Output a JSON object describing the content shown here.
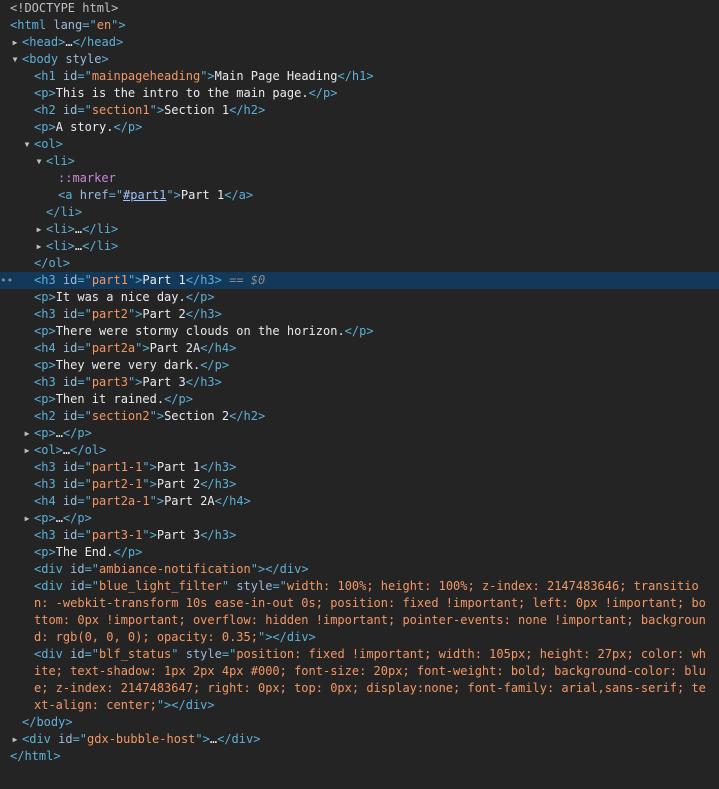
{
  "colors": {
    "background": "#242424",
    "selection": "#12385a",
    "tag": "#5db0d7",
    "attr_name": "#9bbbdc",
    "attr_value": "#f29766",
    "text": "#e8eaed"
  },
  "lines": [
    {
      "depth": 0,
      "parts": [
        {
          "c": "doctype",
          "t": "<!DOCTYPE html>"
        }
      ]
    },
    {
      "depth": 0,
      "parts": [
        {
          "c": "tag",
          "t": "<html "
        },
        {
          "c": "an",
          "t": "lang"
        },
        {
          "c": "tag",
          "t": "=\""
        },
        {
          "c": "av",
          "t": "en"
        },
        {
          "c": "tag",
          "t": "\">"
        }
      ]
    },
    {
      "depth": 1,
      "tri": "right",
      "parts": [
        {
          "c": "tag",
          "t": "<head>"
        },
        {
          "c": "ell",
          "t": "…"
        },
        {
          "c": "tag",
          "t": "</head>"
        }
      ]
    },
    {
      "depth": 1,
      "tri": "down",
      "parts": [
        {
          "c": "tag",
          "t": "<body "
        },
        {
          "c": "an",
          "t": "style"
        },
        {
          "c": "tag",
          "t": ">"
        }
      ]
    },
    {
      "depth": 2,
      "parts": [
        {
          "c": "tag",
          "t": "<h1 "
        },
        {
          "c": "an",
          "t": "id"
        },
        {
          "c": "tag",
          "t": "=\""
        },
        {
          "c": "av",
          "t": "mainpageheading"
        },
        {
          "c": "tag",
          "t": "\">"
        },
        {
          "c": "txt",
          "t": "Main Page Heading"
        },
        {
          "c": "tag",
          "t": "</h1>"
        }
      ]
    },
    {
      "depth": 2,
      "parts": [
        {
          "c": "tag",
          "t": "<p>"
        },
        {
          "c": "txt",
          "t": "This is the intro to the main page."
        },
        {
          "c": "tag",
          "t": "</p>"
        }
      ]
    },
    {
      "depth": 2,
      "parts": [
        {
          "c": "tag",
          "t": "<h2 "
        },
        {
          "c": "an",
          "t": "id"
        },
        {
          "c": "tag",
          "t": "=\""
        },
        {
          "c": "av",
          "t": "section1"
        },
        {
          "c": "tag",
          "t": "\">"
        },
        {
          "c": "txt",
          "t": "Section 1"
        },
        {
          "c": "tag",
          "t": "</h2>"
        }
      ]
    },
    {
      "depth": 2,
      "parts": [
        {
          "c": "tag",
          "t": "<p>"
        },
        {
          "c": "txt",
          "t": "A story."
        },
        {
          "c": "tag",
          "t": "</p>"
        }
      ]
    },
    {
      "depth": 2,
      "tri": "down",
      "parts": [
        {
          "c": "tag",
          "t": "<ol>"
        }
      ]
    },
    {
      "depth": 3,
      "tri": "down",
      "parts": [
        {
          "c": "tag",
          "t": "<li>"
        }
      ]
    },
    {
      "depth": 4,
      "parts": [
        {
          "c": "pseudo",
          "t": "::marker"
        }
      ]
    },
    {
      "depth": 4,
      "parts": [
        {
          "c": "tag",
          "t": "<a "
        },
        {
          "c": "an",
          "t": "href"
        },
        {
          "c": "tag",
          "t": "=\""
        },
        {
          "c": "av link",
          "t": "#part1"
        },
        {
          "c": "tag",
          "t": "\">"
        },
        {
          "c": "txt",
          "t": "Part 1"
        },
        {
          "c": "tag",
          "t": "</a>"
        }
      ]
    },
    {
      "depth": 3,
      "parts": [
        {
          "c": "tag",
          "t": "</li>"
        }
      ]
    },
    {
      "depth": 3,
      "tri": "right",
      "parts": [
        {
          "c": "tag",
          "t": "<li>"
        },
        {
          "c": "ell",
          "t": "…"
        },
        {
          "c": "tag",
          "t": "</li>"
        }
      ]
    },
    {
      "depth": 3,
      "tri": "right",
      "parts": [
        {
          "c": "tag",
          "t": "<li>"
        },
        {
          "c": "ell",
          "t": "…"
        },
        {
          "c": "tag",
          "t": "</li>"
        }
      ]
    },
    {
      "depth": 2,
      "parts": [
        {
          "c": "tag",
          "t": "</ol>"
        }
      ]
    },
    {
      "depth": 2,
      "selected": true,
      "parts": [
        {
          "c": "tag",
          "t": "<h3 "
        },
        {
          "c": "an",
          "t": "id"
        },
        {
          "c": "tag",
          "t": "=\""
        },
        {
          "c": "av",
          "t": "part1"
        },
        {
          "c": "tag",
          "t": "\">"
        },
        {
          "c": "txt",
          "t": "Part 1"
        },
        {
          "c": "tag",
          "t": "</h3>"
        },
        {
          "c": "eq",
          "t": " == $0"
        }
      ]
    },
    {
      "depth": 2,
      "parts": [
        {
          "c": "tag",
          "t": "<p>"
        },
        {
          "c": "txt",
          "t": "It was a nice day."
        },
        {
          "c": "tag",
          "t": "</p>"
        }
      ]
    },
    {
      "depth": 2,
      "parts": [
        {
          "c": "tag",
          "t": "<h3 "
        },
        {
          "c": "an",
          "t": "id"
        },
        {
          "c": "tag",
          "t": "=\""
        },
        {
          "c": "av",
          "t": "part2"
        },
        {
          "c": "tag",
          "t": "\">"
        },
        {
          "c": "txt",
          "t": "Part 2"
        },
        {
          "c": "tag",
          "t": "</h3>"
        }
      ]
    },
    {
      "depth": 2,
      "parts": [
        {
          "c": "tag",
          "t": "<p>"
        },
        {
          "c": "txt",
          "t": "There were stormy clouds on the horizon."
        },
        {
          "c": "tag",
          "t": "</p>"
        }
      ]
    },
    {
      "depth": 2,
      "parts": [
        {
          "c": "tag",
          "t": "<h4 "
        },
        {
          "c": "an",
          "t": "id"
        },
        {
          "c": "tag",
          "t": "=\""
        },
        {
          "c": "av",
          "t": "part2a"
        },
        {
          "c": "tag",
          "t": "\">"
        },
        {
          "c": "txt",
          "t": "Part 2A"
        },
        {
          "c": "tag",
          "t": "</h4>"
        }
      ]
    },
    {
      "depth": 2,
      "parts": [
        {
          "c": "tag",
          "t": "<p>"
        },
        {
          "c": "txt",
          "t": "They were very dark."
        },
        {
          "c": "tag",
          "t": "</p>"
        }
      ]
    },
    {
      "depth": 2,
      "parts": [
        {
          "c": "tag",
          "t": "<h3 "
        },
        {
          "c": "an",
          "t": "id"
        },
        {
          "c": "tag",
          "t": "=\""
        },
        {
          "c": "av",
          "t": "part3"
        },
        {
          "c": "tag",
          "t": "\">"
        },
        {
          "c": "txt",
          "t": "Part 3"
        },
        {
          "c": "tag",
          "t": "</h3>"
        }
      ]
    },
    {
      "depth": 2,
      "parts": [
        {
          "c": "tag",
          "t": "<p>"
        },
        {
          "c": "txt",
          "t": "Then it rained."
        },
        {
          "c": "tag",
          "t": "</p>"
        }
      ]
    },
    {
      "depth": 2,
      "parts": [
        {
          "c": "tag",
          "t": "<h2 "
        },
        {
          "c": "an",
          "t": "id"
        },
        {
          "c": "tag",
          "t": "=\""
        },
        {
          "c": "av",
          "t": "section2"
        },
        {
          "c": "tag",
          "t": "\">"
        },
        {
          "c": "txt",
          "t": "Section 2"
        },
        {
          "c": "tag",
          "t": "</h2>"
        }
      ]
    },
    {
      "depth": 2,
      "tri": "right",
      "parts": [
        {
          "c": "tag",
          "t": "<p>"
        },
        {
          "c": "ell",
          "t": "…"
        },
        {
          "c": "tag",
          "t": "</p>"
        }
      ]
    },
    {
      "depth": 2,
      "tri": "right",
      "parts": [
        {
          "c": "tag",
          "t": "<ol>"
        },
        {
          "c": "ell",
          "t": "…"
        },
        {
          "c": "tag",
          "t": "</ol>"
        }
      ]
    },
    {
      "depth": 2,
      "parts": [
        {
          "c": "tag",
          "t": "<h3 "
        },
        {
          "c": "an",
          "t": "id"
        },
        {
          "c": "tag",
          "t": "=\""
        },
        {
          "c": "av",
          "t": "part1-1"
        },
        {
          "c": "tag",
          "t": "\">"
        },
        {
          "c": "txt",
          "t": "Part 1"
        },
        {
          "c": "tag",
          "t": "</h3>"
        }
      ]
    },
    {
      "depth": 2,
      "parts": [
        {
          "c": "tag",
          "t": "<h3 "
        },
        {
          "c": "an",
          "t": "id"
        },
        {
          "c": "tag",
          "t": "=\""
        },
        {
          "c": "av",
          "t": "part2-1"
        },
        {
          "c": "tag",
          "t": "\">"
        },
        {
          "c": "txt",
          "t": "Part 2"
        },
        {
          "c": "tag",
          "t": "</h3>"
        }
      ]
    },
    {
      "depth": 2,
      "parts": [
        {
          "c": "tag",
          "t": "<h4 "
        },
        {
          "c": "an",
          "t": "id"
        },
        {
          "c": "tag",
          "t": "=\""
        },
        {
          "c": "av",
          "t": "part2a-1"
        },
        {
          "c": "tag",
          "t": "\">"
        },
        {
          "c": "txt",
          "t": "Part 2A"
        },
        {
          "c": "tag",
          "t": "</h4>"
        }
      ]
    },
    {
      "depth": 2,
      "tri": "right",
      "parts": [
        {
          "c": "tag",
          "t": "<p>"
        },
        {
          "c": "ell",
          "t": "…"
        },
        {
          "c": "tag",
          "t": "</p>"
        }
      ]
    },
    {
      "depth": 2,
      "parts": [
        {
          "c": "tag",
          "t": "<h3 "
        },
        {
          "c": "an",
          "t": "id"
        },
        {
          "c": "tag",
          "t": "=\""
        },
        {
          "c": "av",
          "t": "part3-1"
        },
        {
          "c": "tag",
          "t": "\">"
        },
        {
          "c": "txt",
          "t": "Part 3"
        },
        {
          "c": "tag",
          "t": "</h3>"
        }
      ]
    },
    {
      "depth": 2,
      "parts": [
        {
          "c": "tag",
          "t": "<p>"
        },
        {
          "c": "txt",
          "t": "The End."
        },
        {
          "c": "tag",
          "t": "</p>"
        }
      ]
    },
    {
      "depth": 2,
      "parts": [
        {
          "c": "tag",
          "t": "<div "
        },
        {
          "c": "an",
          "t": "id"
        },
        {
          "c": "tag",
          "t": "=\""
        },
        {
          "c": "av",
          "t": "ambiance-notification"
        },
        {
          "c": "tag",
          "t": "\"></div>"
        }
      ]
    },
    {
      "depth": 2,
      "wrap": true,
      "parts": [
        {
          "c": "tag",
          "t": "<div "
        },
        {
          "c": "an",
          "t": "id"
        },
        {
          "c": "tag",
          "t": "=\""
        },
        {
          "c": "av",
          "t": "blue_light_filter"
        },
        {
          "c": "tag",
          "t": "\" "
        },
        {
          "c": "an",
          "t": "style"
        },
        {
          "c": "tag",
          "t": "=\""
        },
        {
          "c": "av",
          "t": "width: 100%; height: 100%; z-index: 2147483646; transition: -webkit-transform 10s ease-in-out 0s; position: fixed !important; left: 0px !important; bottom: 0px !important; overflow: hidden !important; pointer-events: none !important; background: rgb(0, 0, 0); opacity: 0.35;"
        },
        {
          "c": "tag",
          "t": "\"></div>"
        }
      ]
    },
    {
      "depth": 2,
      "wrap": true,
      "parts": [
        {
          "c": "tag",
          "t": "<div "
        },
        {
          "c": "an",
          "t": "id"
        },
        {
          "c": "tag",
          "t": "=\""
        },
        {
          "c": "av",
          "t": "blf_status"
        },
        {
          "c": "tag",
          "t": "\" "
        },
        {
          "c": "an",
          "t": "style"
        },
        {
          "c": "tag",
          "t": "=\""
        },
        {
          "c": "av",
          "t": "position: fixed !important; width: 105px; height: 27px; color: white; text-shadow: 1px 2px 4px #000; font-size: 20px; font-weight: bold; background-color: blue; z-index: 2147483647;    right: 0px; top: 0px; display:none; font-family: arial,sans-serif; text-align: center;"
        },
        {
          "c": "tag",
          "t": "\"></div>"
        }
      ]
    },
    {
      "depth": 1,
      "parts": [
        {
          "c": "tag",
          "t": "</body>"
        }
      ]
    },
    {
      "depth": 1,
      "tri": "right",
      "parts": [
        {
          "c": "tag",
          "t": "<div "
        },
        {
          "c": "an",
          "t": "id"
        },
        {
          "c": "tag",
          "t": "=\""
        },
        {
          "c": "av",
          "t": "gdx-bubble-host"
        },
        {
          "c": "tag",
          "t": "\">"
        },
        {
          "c": "ell",
          "t": "…"
        },
        {
          "c": "tag",
          "t": "</div>"
        }
      ]
    },
    {
      "depth": 0,
      "parts": [
        {
          "c": "tag",
          "t": "</html>"
        }
      ]
    }
  ]
}
